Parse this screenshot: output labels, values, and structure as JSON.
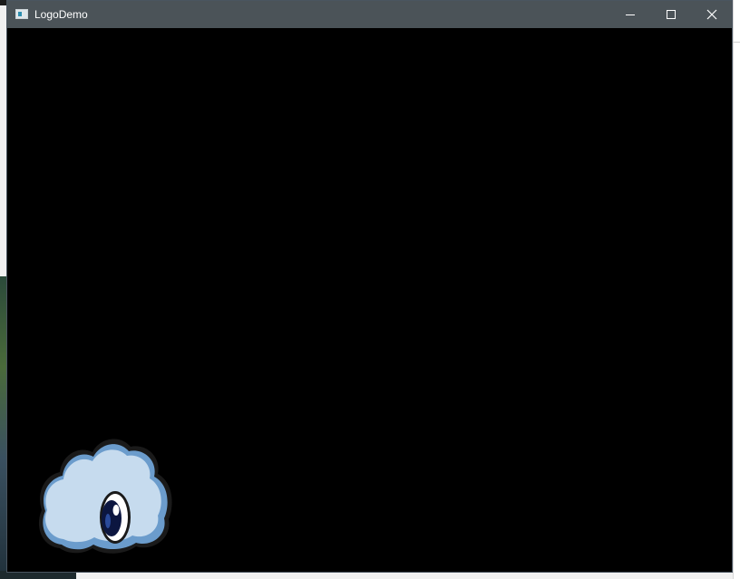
{
  "window": {
    "title": "LogoDemo",
    "title_bar_color": "#4b5358",
    "client_background": "#000000"
  },
  "titlebar": {
    "app_icon": "window-app-icon",
    "minimize_icon": "minimize-icon",
    "maximize_icon": "maximize-icon",
    "close_icon": "close-icon"
  },
  "canvas": {
    "logo": "cloud-eye-logo",
    "logo_colors": {
      "cloud_fill": "#c6dbee",
      "cloud_shadow": "#6b9ccc",
      "outline": "#1a1a1a",
      "pupil": "#0c1640",
      "iris_highlight": "#2a4a9a"
    }
  }
}
